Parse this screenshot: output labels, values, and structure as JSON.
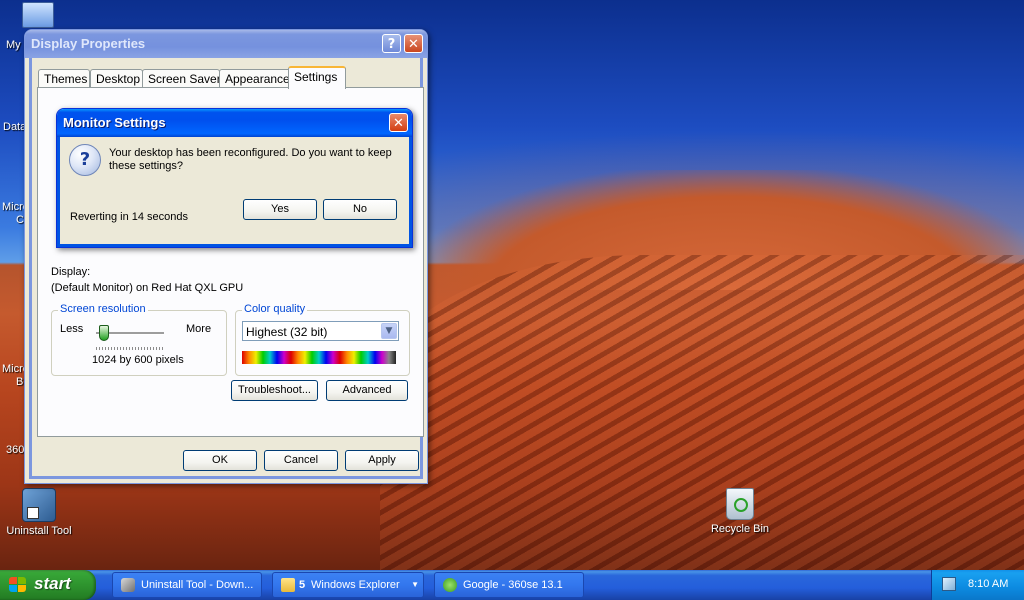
{
  "desktop": {
    "icons": [
      {
        "label": "Uninstall Tool"
      },
      {
        "label": "Recycle Bin"
      }
    ],
    "edge_labels": [
      "My",
      "Data",
      "Micro",
      "C",
      "Micro",
      "B",
      "360"
    ]
  },
  "display_properties": {
    "title": "Display Properties",
    "help_glyph": "?",
    "close_glyph": "✕",
    "tabs": [
      "Themes",
      "Desktop",
      "Screen Saver",
      "Appearance",
      "Settings"
    ],
    "selected_tab": "Settings",
    "display_label": "Display:",
    "display_value": "(Default Monitor) on Red Hat QXL GPU",
    "screen_resolution": {
      "title": "Screen resolution",
      "less": "Less",
      "more": "More",
      "value_text": "1024 by 600 pixels",
      "slider_position": 0.12
    },
    "color_quality": {
      "title": "Color quality",
      "selected": "Highest (32 bit)"
    },
    "buttons": {
      "troubleshoot": "Troubleshoot...",
      "advanced": "Advanced",
      "ok": "OK",
      "cancel": "Cancel",
      "apply": "Apply"
    }
  },
  "monitor_settings": {
    "title": "Monitor Settings",
    "close_glyph": "✕",
    "message_line1": "Your desktop has been reconfigured.  Do you want to keep",
    "message_line2": "these settings?",
    "countdown": "Reverting in 14 seconds",
    "yes": "Yes",
    "no": "No"
  },
  "taskbar": {
    "start_label": "start",
    "items": [
      {
        "label": "Uninstall Tool - Down..."
      },
      {
        "count": "5",
        "label": "Windows Explorer"
      },
      {
        "label": "Google - 360se 13.1"
      }
    ],
    "clock": "8:10 AM"
  },
  "colors": {
    "xp_blue": "#0054e3",
    "window_face": "#ece9d8",
    "start_green": "#2c8f2c",
    "tray_blue": "#0c8ae0"
  }
}
